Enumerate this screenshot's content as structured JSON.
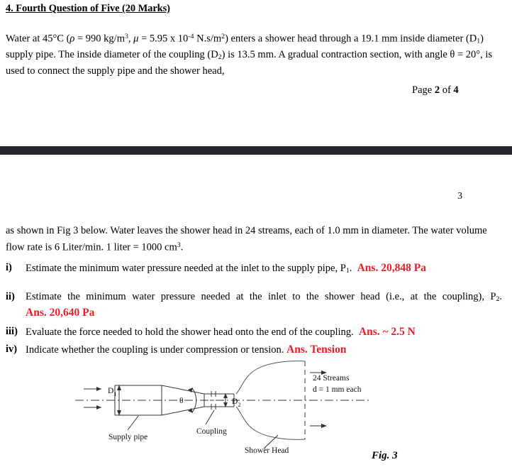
{
  "document": {
    "heading": "4. Fourth Question of Five (20 Marks)",
    "intro_paragraph": {
      "part1": "Water at 45°C (",
      "rho_symbol": "ρ",
      "part2": " = 990 kg/m",
      "rho_exp": "3",
      "part3": ", ",
      "mu_symbol": "μ",
      "part4": " = 5.95 x 10",
      "mu_exp": "-4",
      "part5": " N.s/m",
      "unit_exp": "2",
      "part6": ") enters a shower head through a 19.1 mm inside diameter (D",
      "d1_sub": "1",
      "part7": ") supply pipe. The inside diameter of the coupling (D",
      "d2_sub": "2",
      "part8": ") is 13.5 mm. A gradual contraction section, with angle θ = 20°, is used to connect the supply pipe and the shower head,"
    },
    "page_label": {
      "prefix": "Page ",
      "current": "2",
      "middle": " of ",
      "total": "4"
    },
    "slide_number": "3",
    "body_paragraph": {
      "part1": "as shown in Fig 3 below. Water leaves the shower head in 24 streams, each of 1.0 mm in diameter. The water volume flow rate is 6 Liter/min. 1 liter = 1000 cm",
      "exp": "3",
      "part2": "."
    },
    "questions": [
      {
        "marker": "i)",
        "text_before": "Estimate the minimum water pressure needed at the inlet to the supply pipe, P",
        "sub": "1",
        "text_after": ".",
        "answer": "Ans. 20,848 Pa"
      },
      {
        "marker": "ii)",
        "text_before": "Estimate the minimum water pressure needed at the inlet to the shower head (i.e., at the coupling), P",
        "sub": "2",
        "text_after": ".",
        "answer": "Ans. 20,640 Pa"
      },
      {
        "marker": "iii)",
        "text_before": "Evaluate the force needed to hold the shower head onto the end of the coupling.",
        "sub": "",
        "text_after": "",
        "answer": "Ans. ~ 2.5 N"
      },
      {
        "marker": "iv)",
        "text_before": "Indicate whether the coupling is under compression or tension.",
        "sub": "",
        "text_after": "",
        "answer": "Ans. Tension"
      }
    ],
    "figure": {
      "caption": "Fig. 3",
      "labels": {
        "d1": "D",
        "d1_sub": "1",
        "d2": "D",
        "d2_sub": "2",
        "theta": "θ",
        "supply_pipe": "Supply pipe",
        "coupling": "Coupling",
        "shower_head": "Shower Head",
        "streams_line1": "24 Streams",
        "streams_line2": "d =  1 mm each"
      }
    },
    "colors": {
      "answer_red": "#ee1c24",
      "separator_bar": "#26262b",
      "text": "#000000"
    }
  }
}
